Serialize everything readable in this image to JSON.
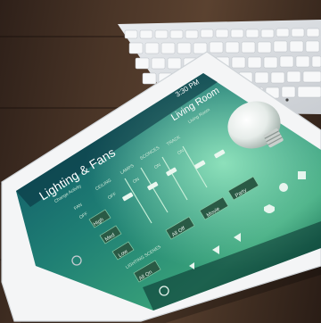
{
  "screen": {
    "title": "Lighting & Fans",
    "subtitle": "Change Activity",
    "room": "Living Room",
    "room_sub": "Living Room",
    "time": "3:30 PM"
  },
  "controls": {
    "fan_label": "FAN",
    "fan_toggle": "OFF",
    "fan_speeds": [
      "High",
      "Med",
      "Low"
    ],
    "slider_labels": [
      "CEILING",
      "LAMPS",
      "SCONCES",
      "TRACK"
    ],
    "slider_toggles": [
      "OFF",
      "ON",
      "ON",
      "ON"
    ],
    "scene_label": "LIGHTING SCENES",
    "scene_buttons": [
      "All On",
      "All Off",
      "Movie",
      "Party"
    ]
  },
  "colors": {
    "screen_top": "#0e5a6b",
    "screen_mid": "#2f8a6d",
    "screen_glow": "#66c9a5",
    "button": "#2a5a45"
  },
  "icons": [
    "power-icon",
    "lightbulb-icon",
    "volume-down-icon",
    "volume-up-icon",
    "mute-icon",
    "shield-icon",
    "moon-icon",
    "grid-icon"
  ]
}
